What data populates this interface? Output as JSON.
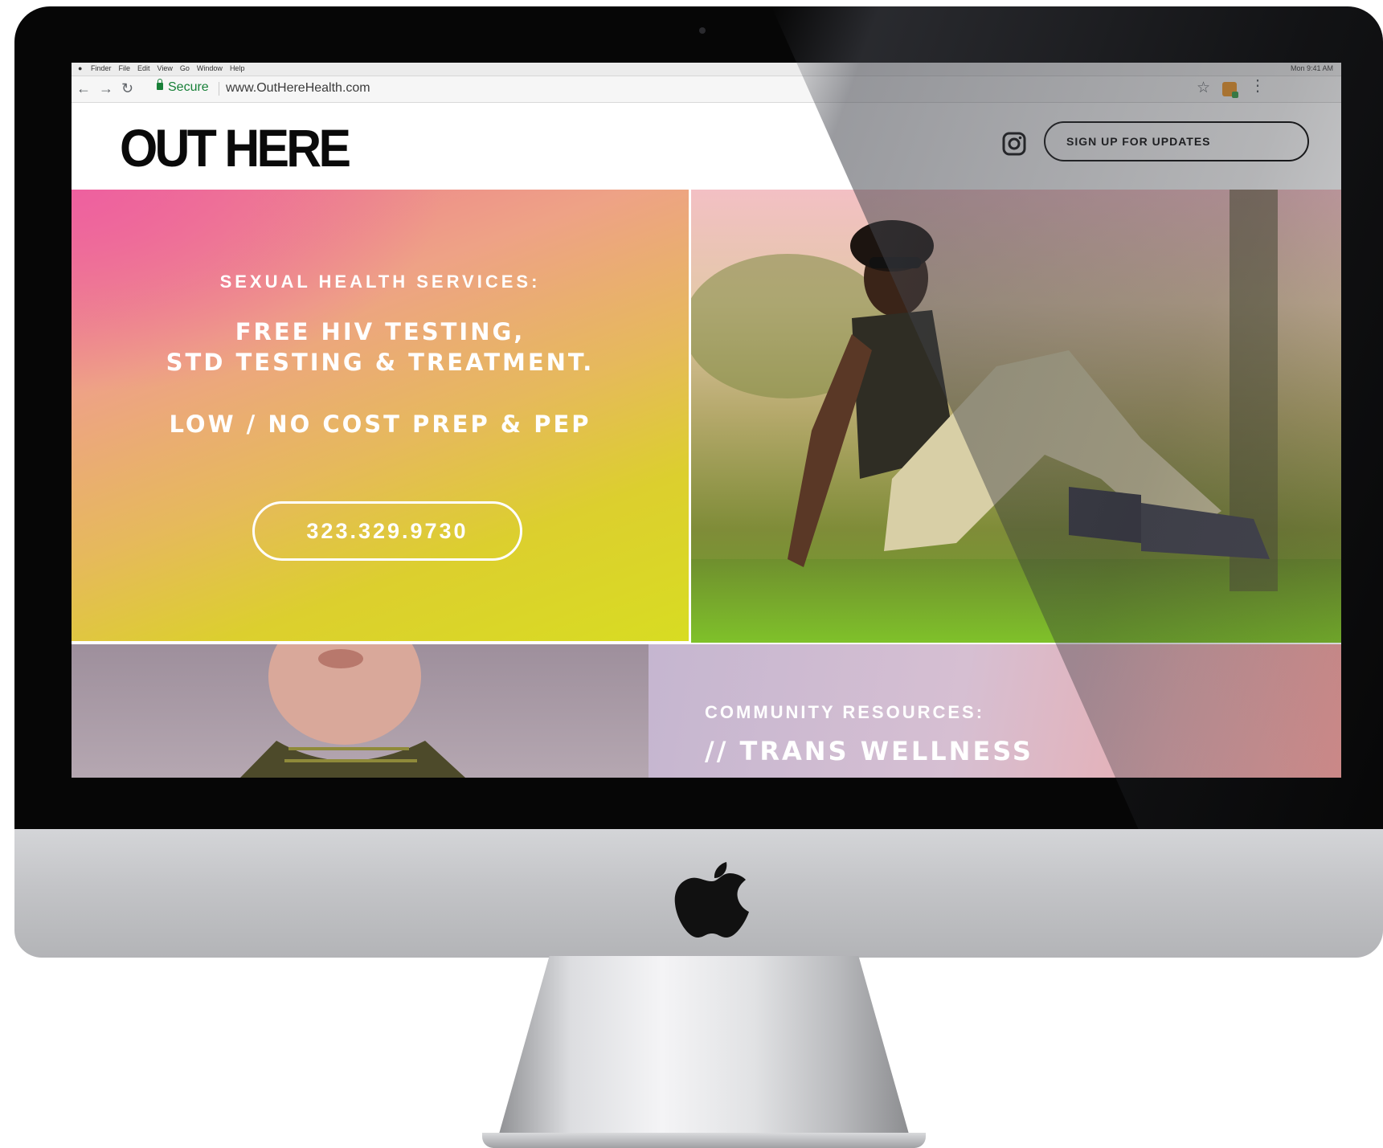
{
  "menubar": {
    "items": [
      "Finder",
      "File",
      "Edit",
      "View",
      "Go",
      "Window",
      "Help"
    ],
    "status_text": "Mon 9:41 AM"
  },
  "browser": {
    "secure_label": "Secure",
    "url": "www.OutHereHealth.com"
  },
  "header": {
    "logo_text": "OUT HERE",
    "signup_label": "SIGN UP FOR UPDATES"
  },
  "hero": {
    "services_label": "SEXUAL HEALTH SERVICES:",
    "line1": "FREE HIV TESTING,",
    "line2": "STD TESTING & TREATMENT.",
    "line3": "LOW / NO COST PREP & PEP",
    "phone": "323.329.9730"
  },
  "community": {
    "label": "COMMUNITY RESOURCES:",
    "title": "// TRANS WELLNESS"
  },
  "colors": {
    "gradient_pink": "#ec7690",
    "gradient_yellow": "#d8dc22",
    "secure_green": "#188038"
  },
  "icons": [
    "apple-icon",
    "back-icon",
    "forward-icon",
    "reload-icon",
    "lock-icon",
    "star-icon",
    "extension-icon",
    "menu-icon",
    "instagram-icon"
  ]
}
